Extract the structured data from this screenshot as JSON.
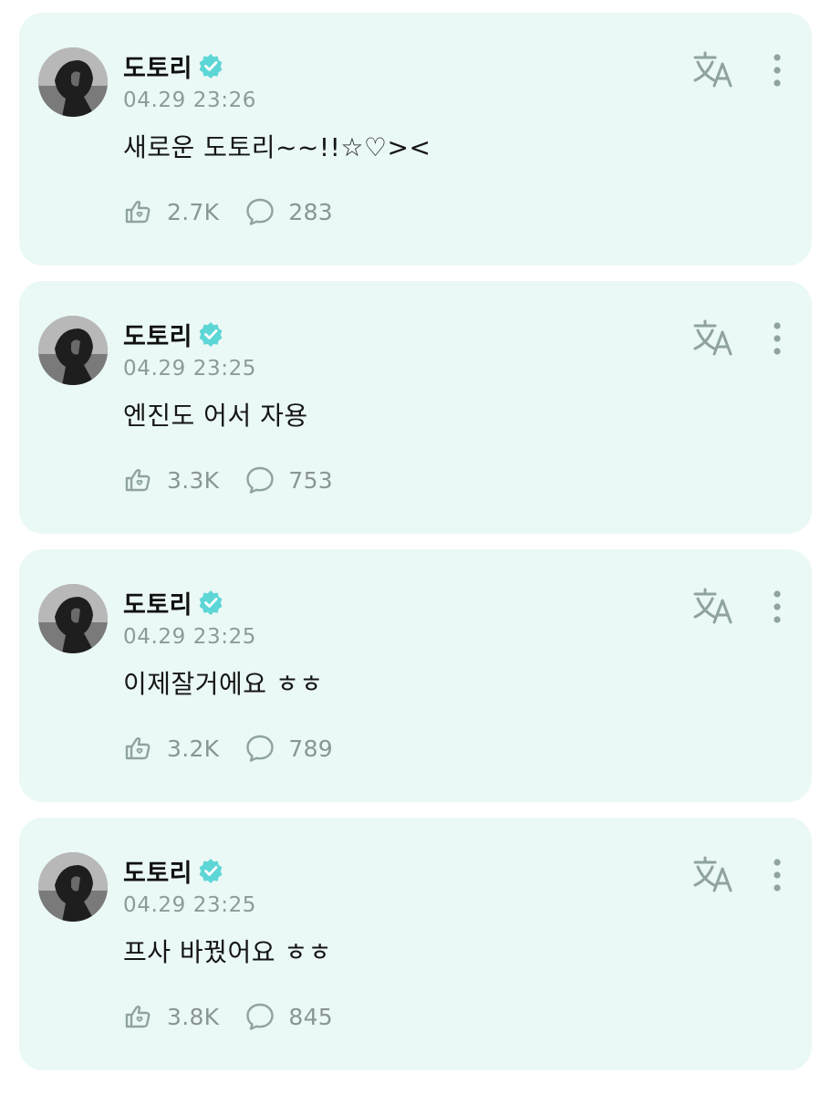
{
  "posts": [
    {
      "author": "도토리",
      "timestamp": "04.29 23:26",
      "text": "새로운 도토리~~!!☆♡><",
      "likes": "2.7K",
      "comments": "283"
    },
    {
      "author": "도토리",
      "timestamp": "04.29 23:25",
      "text": "엔진도 어서 자용",
      "likes": "3.3K",
      "comments": "753"
    },
    {
      "author": "도토리",
      "timestamp": "04.29 23:25",
      "text": "이제잘거에요 ㅎㅎ",
      "likes": "3.2K",
      "comments": "789"
    },
    {
      "author": "도토리",
      "timestamp": "04.29 23:25",
      "text": "프사 바꿨어요 ㅎㅎ",
      "likes": "3.8K",
      "comments": "845"
    }
  ],
  "icons": {
    "verified": "verified-badge-icon",
    "like": "heart-hand-icon",
    "comment": "speech-bubble-icon",
    "translate": "translate-icon",
    "more": "more-vertical-icon"
  },
  "colors": {
    "card_background": "#eaf8f6",
    "verified_badge": "#5dd6d6",
    "muted_text": "#8d9a99",
    "icon": "#8fa3a1"
  }
}
